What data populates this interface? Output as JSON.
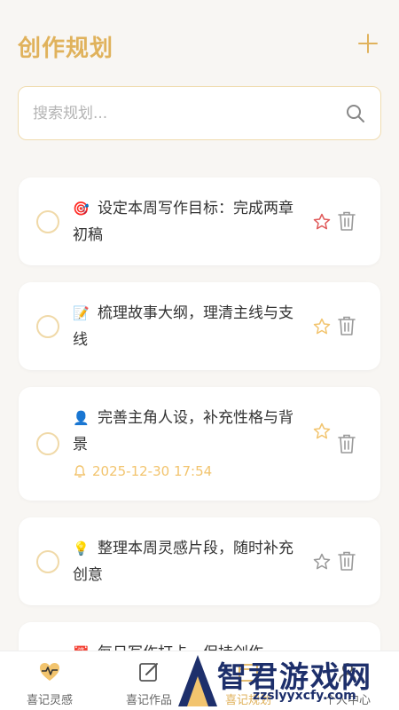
{
  "header": {
    "title": "创作规划",
    "add_label": "+"
  },
  "search": {
    "placeholder": "搜索规划..."
  },
  "tasks": [
    {
      "emoji": "🎯",
      "text": "设定本周写作目标：完成两章初稿",
      "starred": true,
      "star_color": "#e05a5a"
    },
    {
      "emoji": "📝",
      "text": "梳理故事大纲，理清主线与支线",
      "starred": false,
      "star_color": "#f2c46e"
    },
    {
      "emoji": "👤",
      "text": "完善主角人设，补充性格与背景",
      "starred": false,
      "star_color": "#f2c46e",
      "reminder": "2025-12-30 17:54"
    },
    {
      "emoji": "💡",
      "text": "整理本周灵感片段，随时补充创意",
      "starred": false,
      "star_color": "#999999"
    },
    {
      "emoji": "📅",
      "text": "每日写作打卡，保持创作"
    }
  ],
  "tabbar": {
    "tabs": [
      {
        "label": "喜记灵感",
        "icon": "heart-pulse-icon"
      },
      {
        "label": "喜记作品",
        "icon": "edit-icon"
      },
      {
        "label": "喜记规划",
        "icon": "calendar-icon"
      },
      {
        "label": "个人中心",
        "icon": "user-icon"
      }
    ],
    "active_index": 2
  },
  "watermark": {
    "text": "智君游戏网",
    "url": "zzslyyxcfy.com"
  },
  "colors": {
    "accent": "#e0b25c",
    "background": "#f8f6f3",
    "star_active": "#e05a5a"
  }
}
